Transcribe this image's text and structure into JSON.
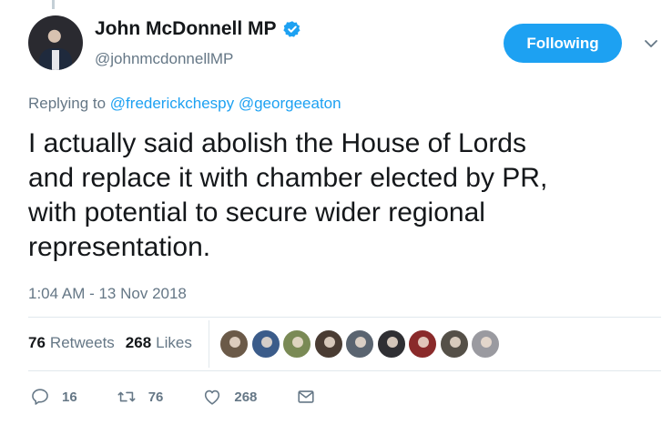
{
  "author": {
    "name": "John McDonnell MP",
    "handle": "@johnmcdonnellMP",
    "verified": true
  },
  "follow_button": {
    "label": "Following",
    "color": "#1da1f2"
  },
  "reply_context": {
    "prefix": "Replying to",
    "mentions": [
      "@frederickchespy",
      "@georgeeaton"
    ]
  },
  "tweet": {
    "text": "I actually said abolish the House of Lords\nand replace it with chamber elected by PR,\nwith potential to secure wider regional\nrepresentation.",
    "timestamp": "1:04 AM - 13 Nov 2018"
  },
  "stats": {
    "retweets_count": "76",
    "retweets_label": "Retweets",
    "likes_count": "268",
    "likes_label": "Likes"
  },
  "liker_avatars": [
    {
      "name": "liker-avatar-1",
      "color": "#6b5a48"
    },
    {
      "name": "liker-avatar-2",
      "color": "#3b5c8a"
    },
    {
      "name": "liker-avatar-3",
      "color": "#7a8a55"
    },
    {
      "name": "liker-avatar-4",
      "color": "#4a3c33"
    },
    {
      "name": "liker-avatar-5",
      "color": "#5a6470"
    },
    {
      "name": "liker-avatar-6",
      "color": "#2f2f33"
    },
    {
      "name": "liker-avatar-7",
      "color": "#8a2a2a"
    },
    {
      "name": "liker-avatar-8",
      "color": "#555048"
    },
    {
      "name": "liker-avatar-9",
      "color": "#9a9aa0"
    }
  ],
  "actions": {
    "reply_count": "16",
    "retweet_count": "76",
    "like_count": "268",
    "reply_icon": "reply-icon",
    "retweet_icon": "retweet-icon",
    "like_icon": "heart-icon",
    "message_icon": "envelope-icon"
  }
}
